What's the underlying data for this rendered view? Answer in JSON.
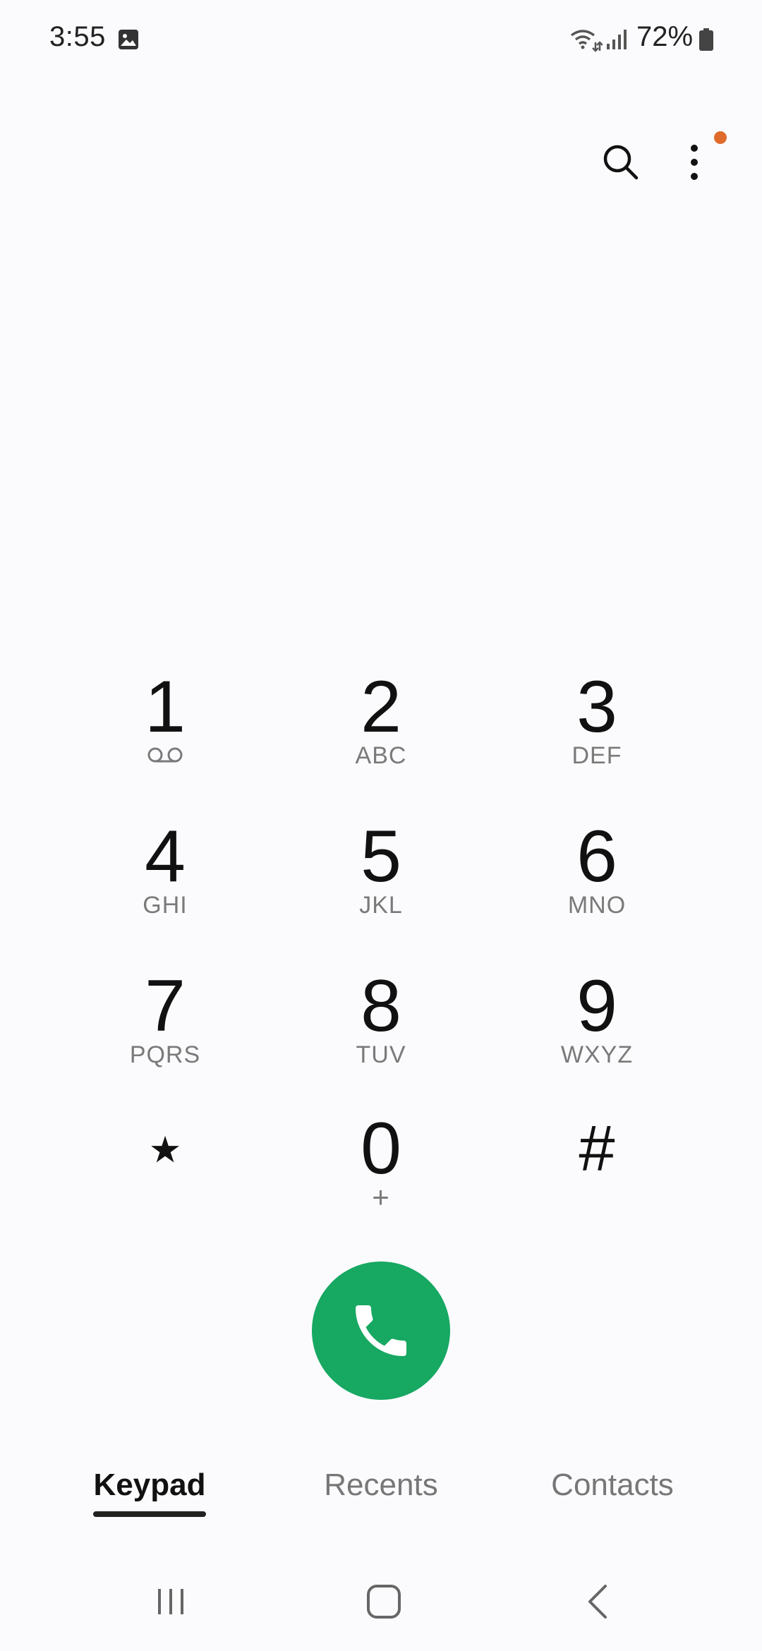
{
  "status_bar": {
    "time": "3:55",
    "battery": "72%",
    "icons": [
      "gallery-icon",
      "wifi-icon",
      "signal-icon",
      "battery-icon"
    ]
  },
  "toolbar": {
    "search_icon": "search-icon",
    "more_icon": "more-options-icon",
    "notification_dot_color": "#e06a2c"
  },
  "keypad": {
    "keys": [
      {
        "digit": "1",
        "letters": "",
        "icon": "voicemail-icon"
      },
      {
        "digit": "2",
        "letters": "ABC"
      },
      {
        "digit": "3",
        "letters": "DEF"
      },
      {
        "digit": "4",
        "letters": "GHI"
      },
      {
        "digit": "5",
        "letters": "JKL"
      },
      {
        "digit": "6",
        "letters": "MNO"
      },
      {
        "digit": "7",
        "letters": "PQRS"
      },
      {
        "digit": "8",
        "letters": "TUV"
      },
      {
        "digit": "9",
        "letters": "WXYZ"
      },
      {
        "digit": "⋆",
        "letters": ""
      },
      {
        "digit": "0",
        "letters": "+"
      },
      {
        "digit": "#",
        "letters": ""
      }
    ]
  },
  "call_button": {
    "icon": "phone-icon",
    "color": "#17a862"
  },
  "tabs": [
    {
      "label": "Keypad",
      "active": true
    },
    {
      "label": "Recents",
      "active": false
    },
    {
      "label": "Contacts",
      "active": false
    }
  ],
  "nav_bar": {
    "icons": [
      "recent-apps-icon",
      "home-icon",
      "back-icon"
    ]
  }
}
